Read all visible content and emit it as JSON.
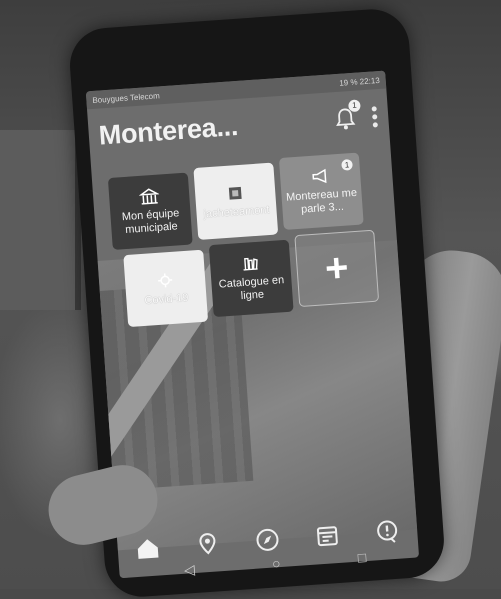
{
  "status_bar": {
    "carrier": "Bouygues Telecom",
    "battery": "19 %",
    "time": "22:13"
  },
  "header": {
    "title": "Monterea...",
    "notification_count": "1"
  },
  "tiles": [
    {
      "label": "Mon équipe municipale",
      "icon": "town-hall-icon"
    },
    {
      "label": "jacheteamont",
      "icon": "shop-icon"
    },
    {
      "label": "Montereau me parle 3...",
      "icon": "megaphone-icon",
      "badge": "1"
    },
    {
      "label": "Covid-19",
      "icon": "virus-icon"
    },
    {
      "label": "Catalogue en ligne",
      "icon": "books-icon"
    },
    {
      "label": "+",
      "icon": "plus-icon"
    }
  ],
  "bottom_nav": [
    "home-icon",
    "map-pin-icon",
    "compass-icon",
    "calendar-icon",
    "alert-icon"
  ],
  "system_nav": {
    "back": "◁",
    "home": "○",
    "recents": "□"
  }
}
